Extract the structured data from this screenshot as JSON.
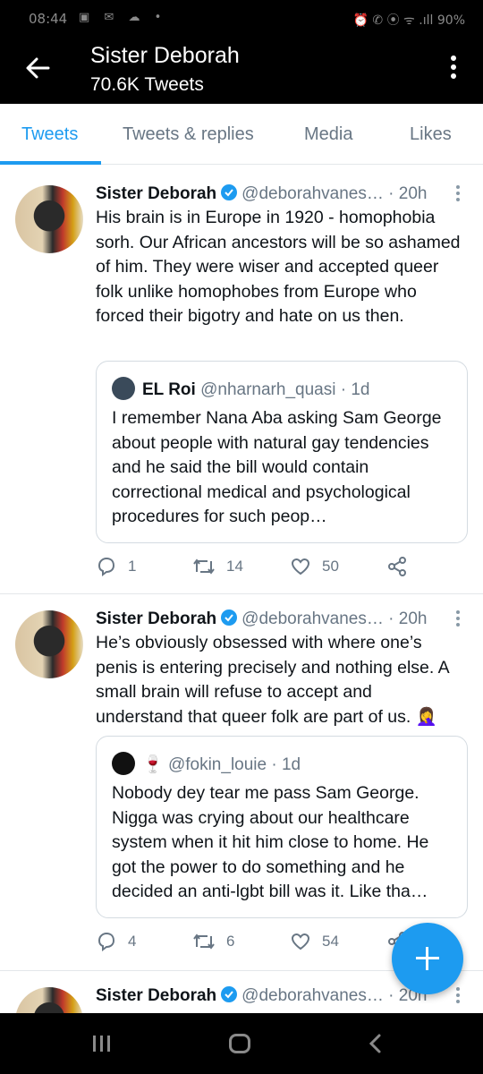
{
  "status": {
    "time": "08:44",
    "left_icons": "▣ ✉ ☁ •",
    "right_icons": "⏰ ✆ ⦿ ᯤ .ıll",
    "battery": "90%"
  },
  "appbar": {
    "title": "Sister Deborah",
    "subtitle": "70.6K Tweets"
  },
  "tabs": [
    {
      "label": "Tweets"
    },
    {
      "label": "Tweets & replies"
    },
    {
      "label": "Media"
    },
    {
      "label": "Likes"
    }
  ],
  "tweets": [
    {
      "name": "Sister Deborah",
      "handle": "@deborahvanes…",
      "time": "· 20h",
      "text": "His brain is in Europe in 1920 - homophobia sorh. Our African ancestors will be so ashamed of him. They were wiser and accepted queer folk unlike homophobes from Europe who forced their bigotry and hate on us then.",
      "quote": {
        "name": "EL Roi",
        "handle": "@nharnarh_quasi",
        "time": "· 1d",
        "text": "I remember Nana Aba asking Sam George about people with natural gay tendencies and he said the bill would contain correctional medical and psychological procedures for such peop…"
      },
      "replies": "1",
      "retweets": "14",
      "likes": "50"
    },
    {
      "name": "Sister Deborah",
      "handle": "@deborahvanes…",
      "time": "· 20h",
      "text": "He’s obviously obsessed with where one’s penis is entering precisely and nothing else. A small brain will refuse to accept and understand that queer folk are part of us. 🤦‍♀️",
      "quote": {
        "name": "🍷",
        "handle": "@fokin_louie",
        "time": "· 1d",
        "text": "Nobody dey tear me pass Sam George. Nigga was crying about our healthcare system when it hit him close to home. He got the power to do something and he decided an anti-lgbt bill was it. Like tha…"
      },
      "replies": "4",
      "retweets": "6",
      "likes": "54"
    },
    {
      "name": "Sister Deborah",
      "handle": "@deborahvanes…",
      "time": "· 20h"
    }
  ],
  "colors": {
    "accent": "#1d9bf0",
    "text": "#0f1419",
    "muted": "#687684",
    "bar": "#000000"
  }
}
